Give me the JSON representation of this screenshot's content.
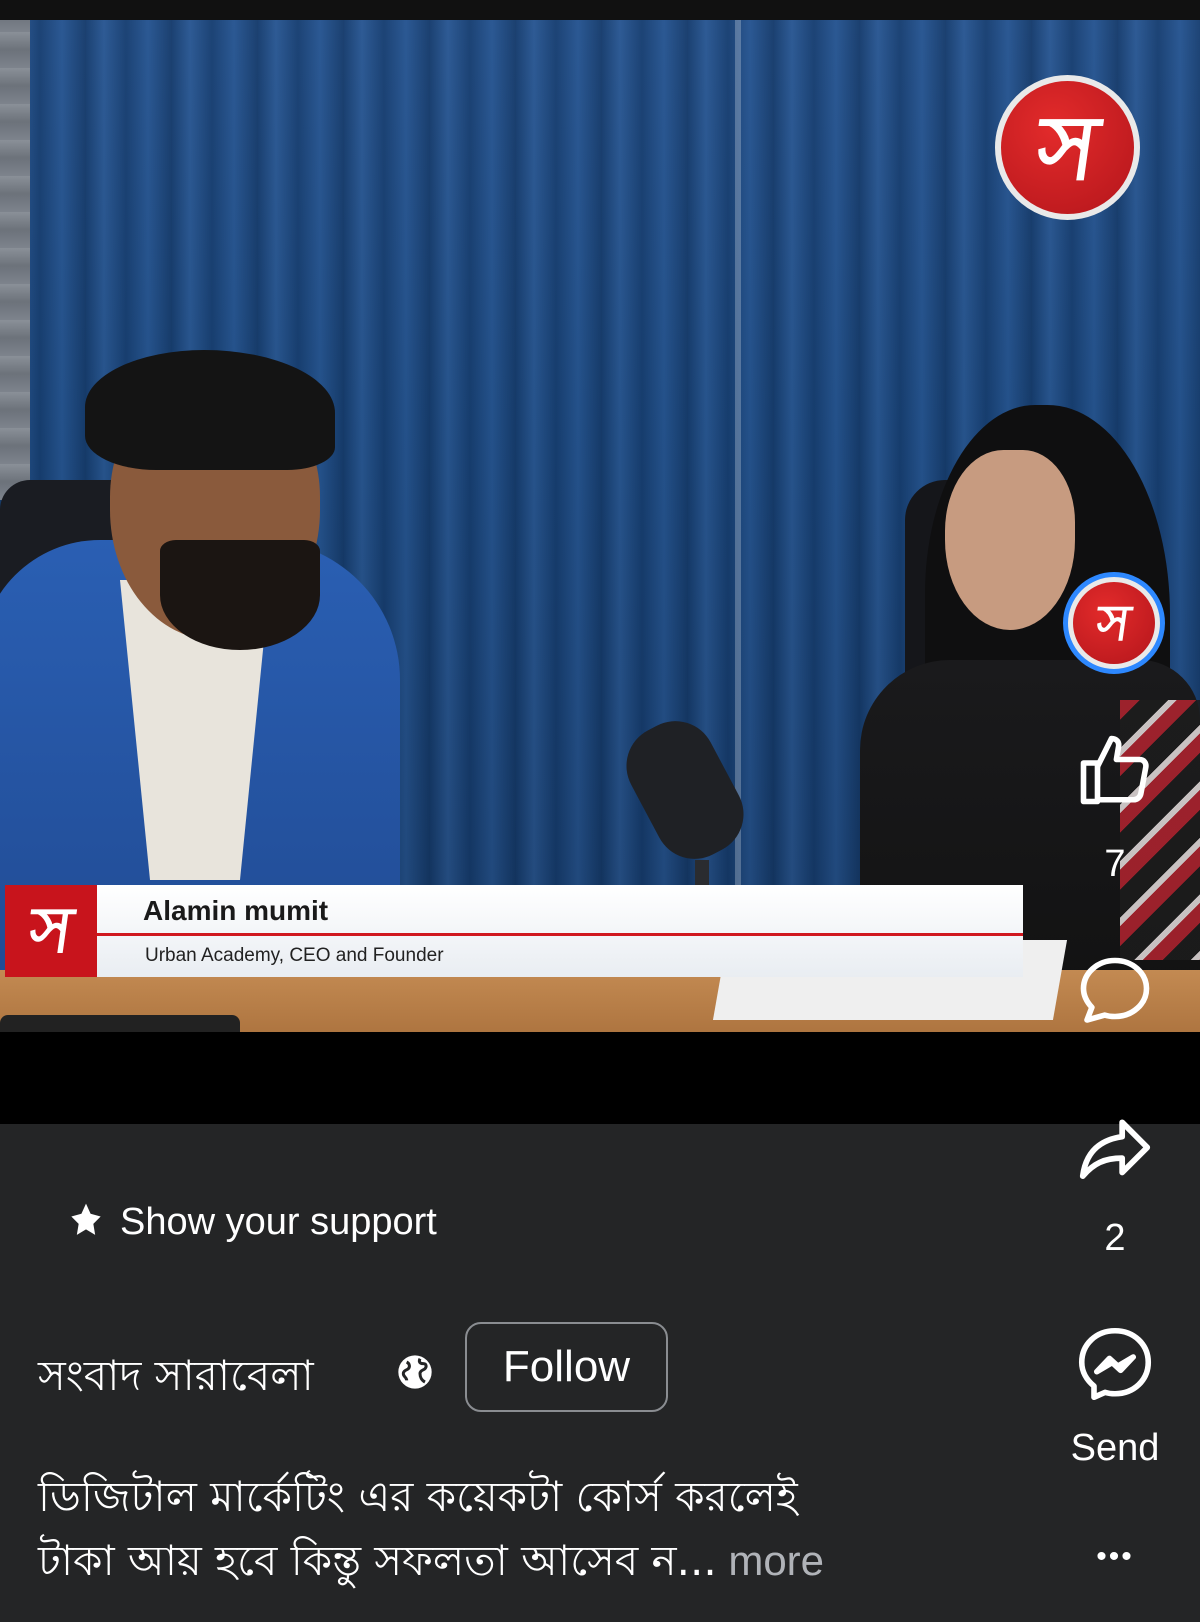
{
  "video": {
    "lower_third": {
      "name": "Alamin mumit",
      "title": "Urban Academy, CEO and Founder"
    }
  },
  "actions": {
    "like_count": "7",
    "share_count": "2",
    "send_label": "Send",
    "more_label": "•••"
  },
  "post": {
    "support_label": "Show your support",
    "page_name": "সংবাদ সারাবেলা",
    "follow_label": "Follow",
    "caption_line1": "ডিজিটাল মার্কেটিং এর কয়েকটা কোর্স করলেই",
    "caption_line2": "টাকা আয় হবে কিন্তু সফলতা আসেব ন...",
    "caption_more": " more"
  },
  "brand": {
    "logo_glyph": "স",
    "accent": "#c8141c",
    "follow_border": "#8a8d91",
    "background": "#242526"
  }
}
